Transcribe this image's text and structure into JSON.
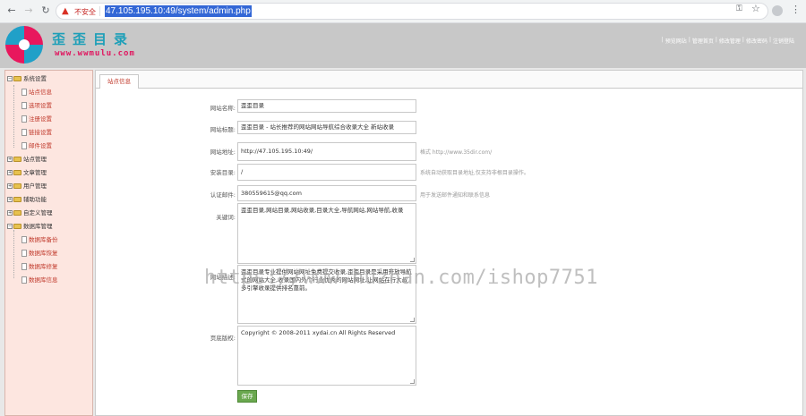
{
  "browser": {
    "insecure_label": "不安全",
    "url": "47.105.195.10:49/system/admin.php"
  },
  "header": {
    "logo_text": "歪歪目录",
    "logo_sub": "www.wwmulu.com",
    "top_links": [
      "预览网站",
      "管理首页",
      "修改管理",
      "修改密码",
      "注销登陆"
    ]
  },
  "sidebar": {
    "tree": [
      {
        "label": "系统设置",
        "type": "folder",
        "expanded": true
      },
      {
        "label": "站点信息",
        "type": "doc"
      },
      {
        "label": "选项设置",
        "type": "doc"
      },
      {
        "label": "注册设置",
        "type": "doc"
      },
      {
        "label": "链接设置",
        "type": "doc"
      },
      {
        "label": "邮件设置",
        "type": "doc"
      },
      {
        "label": "站点管理",
        "type": "folder",
        "expanded": false
      },
      {
        "label": "文章管理",
        "type": "folder",
        "expanded": false
      },
      {
        "label": "用户管理",
        "type": "folder",
        "expanded": false
      },
      {
        "label": "辅助功能",
        "type": "folder",
        "expanded": false
      },
      {
        "label": "自定义管理",
        "type": "folder",
        "expanded": false
      },
      {
        "label": "数据库管理",
        "type": "folder",
        "expanded": true
      },
      {
        "label": "数据库备份",
        "type": "doc"
      },
      {
        "label": "数据库恢复",
        "type": "doc"
      },
      {
        "label": "数据库修复",
        "type": "doc"
      },
      {
        "label": "数据库信息",
        "type": "doc"
      }
    ]
  },
  "content": {
    "tab": "站点信息",
    "form": {
      "site_name_label": "网站名称:",
      "site_name_value": "歪歪目录",
      "site_title_label": "网站标题:",
      "site_title_value": "歪歪目录 - 站长推荐的网站网站导航综合收录大全 新站收录",
      "site_url_label": "网站地址:",
      "site_url_value": "http://47.105.195.10:49/",
      "site_url_hint": "格式 http://www.35dir.com/",
      "install_dir_label": "安装目录:",
      "install_dir_value": "/",
      "install_dir_hint": "系统自动获取目录地址,仅支持非根目录操作。",
      "admin_email_label": "认证邮件:",
      "admin_email_value": "380559615@qq.com",
      "admin_email_hint": "用于发送邮件通知和联系信息",
      "keywords_label": "关键词:",
      "keywords_value": "歪歪目录,网站目录,网站收录,目录大全,导航网站,网站导航,收录",
      "description_label": "网站描述:",
      "description_value": "歪歪目录专业提供网站网址免费提交收录,歪歪目录是采用开放导航式的网站大全,收录国内外个行业优秀的网站网址,让网站在行大叔多引擎收录提供排名靠前。",
      "copyright_label": "页底版权:",
      "copyright_value": "Copyright © 2008-2011 xydai.cn All Rights Reserved",
      "save_label": "保存"
    }
  },
  "watermark": "https://www.huzhan.com/ishop7751"
}
